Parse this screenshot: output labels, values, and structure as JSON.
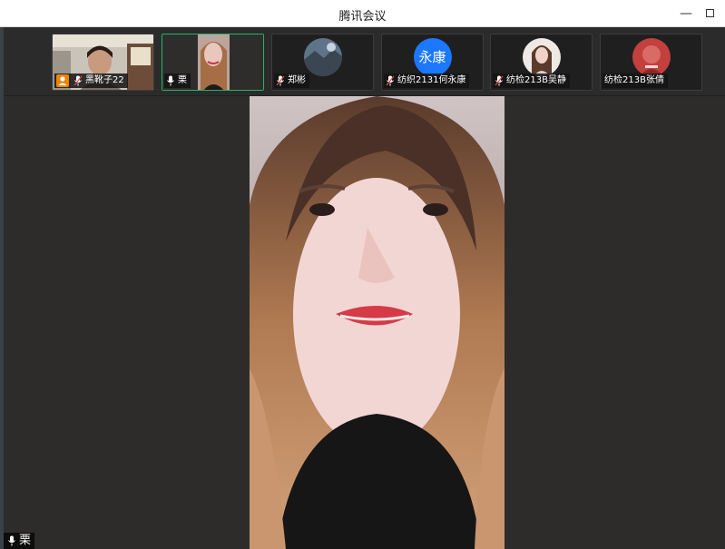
{
  "window": {
    "title": "腾讯会议",
    "minimize_icon": "minimize-icon",
    "maximize_icon": "maximize-icon"
  },
  "participants": [
    {
      "name": "黑靴子22",
      "role_icon": "host-icon",
      "mic": "mic-muted-icon",
      "tile": "video"
    },
    {
      "name": "栗",
      "mic": "mic-icon",
      "tile": "video",
      "active": true
    },
    {
      "name": "郑彬",
      "mic": "mic-muted-icon",
      "tile": "avatar"
    },
    {
      "name": "纺织2131何永康",
      "mic": "mic-muted-icon",
      "tile": "initials",
      "initials": "永康"
    },
    {
      "name": "纺检213B吴静",
      "mic": "mic-muted-icon",
      "tile": "avatar"
    },
    {
      "name": "纺检213B张倩",
      "tile": "avatar"
    }
  ],
  "main_speaker": {
    "name": "栗",
    "mic": "mic-icon"
  },
  "colors": {
    "active_border": "#24b36b",
    "host_badge": "#f08300",
    "initials_avatar": "#1b78ff"
  }
}
